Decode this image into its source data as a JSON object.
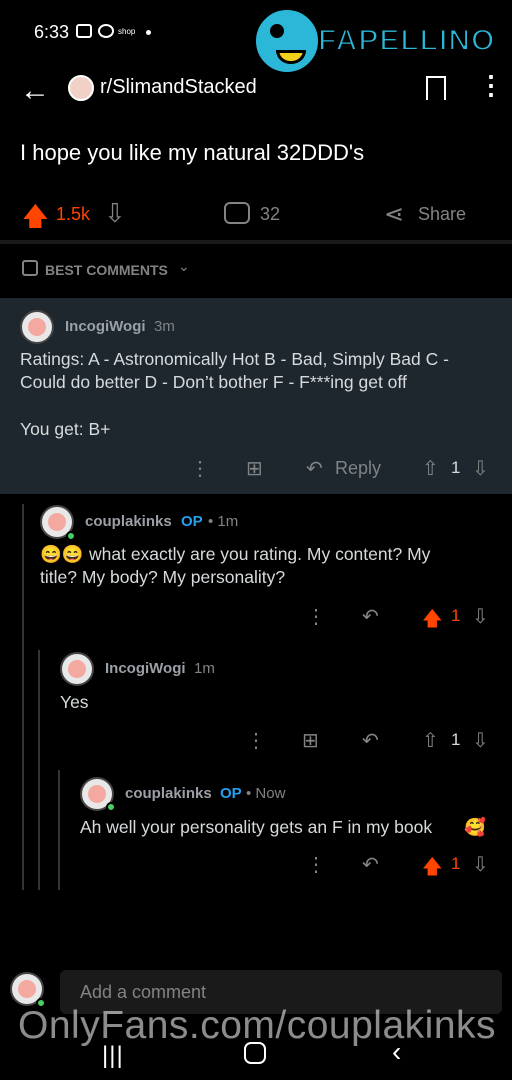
{
  "status_bar": {
    "time": "6:33",
    "shop_label": "shop"
  },
  "watermark_brand": "FAPELLINO",
  "header": {
    "back_glyph": "←",
    "subreddit": "r/SlimandStacked",
    "more_glyph": "⋮"
  },
  "post": {
    "title": "I hope you like my natural 32DDD's",
    "score": "1.5k",
    "comment_count": "32",
    "share_label": "Share"
  },
  "sort": {
    "label": "BEST COMMENTS"
  },
  "comments": [
    {
      "author": "IncogiWogi",
      "time": "3m",
      "body_line1": "Ratings: A - Astronomically Hot B - Bad, Simply Bad C -",
      "body_line2": "Could do better D - Don’t bother F - F***ing get off",
      "body_line3": "You get: B+",
      "reply_label": "Reply",
      "score": "1"
    },
    {
      "author": "couplakinks",
      "op": "OP",
      "time": "• 1m",
      "emoji": "😄😄",
      "body_line1": "what exactly are you rating. My content? My",
      "body_line2": "title? My body? My personality?",
      "score": "1"
    },
    {
      "author": "IncogiWogi",
      "time": "1m",
      "body_line1": "Yes",
      "score": "1"
    },
    {
      "author": "couplakinks",
      "op": "OP",
      "time": "• Now",
      "body_line1": "Ah well your personality gets an F in my book",
      "emoji": "🥰",
      "score": "1"
    }
  ],
  "composer": {
    "placeholder": "Add a comment"
  },
  "watermark_text": "OnlyFans.com/couplakinks",
  "colors": {
    "upvote": "#ff4500",
    "op": "#24a0ed",
    "highlight_bg": "#1e272e",
    "muted": "#818384"
  }
}
